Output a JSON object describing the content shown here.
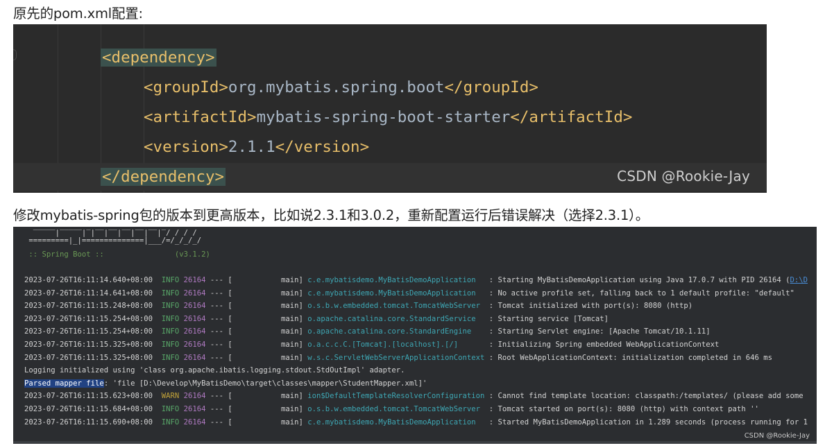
{
  "captions": {
    "top": "原先的pom.xml配置:",
    "middle": "修改mybatis-spring包的版本到更高版本，比如说2.3.1和3.0.2，重新配置运行后错误解决（选择2.3.1）。"
  },
  "code": {
    "lines": [
      {
        "open": "<dependency>"
      },
      {
        "open": "<groupId>",
        "text": "org.mybatis.spring.boot",
        "close": "</groupId>"
      },
      {
        "open": "<artifactId>",
        "text": "mybatis-spring-boot-starter",
        "close": "</artifactId>"
      },
      {
        "open": "<version>",
        "text": "2.1.1",
        "close": "</version>"
      },
      {
        "open": "</dependency>"
      }
    ],
    "watermark": "CSDN @Rookie-Jay",
    "colors": {
      "background": "#2b2b2b",
      "tag": "#e8bf6a",
      "text": "#a9b7c6",
      "tag_highlight": "#3b514d"
    }
  },
  "console": {
    "banner": [
      " =========|_|==============|___/=/_/_/_/",
      " :: Spring Boot ::                (v3.1.2)"
    ],
    "logs": [
      {
        "ts": "2023-07-26T16:11:14.640+08:00",
        "level": "INFO",
        "pid": "26164",
        "sep": "--- [",
        "thread": "           main]",
        "logger": "c.e.mybatisdemo.MyBatisDemoApplication  ",
        "msg": " : Starting MyBatisDemoApplication using Java 17.0.7 with PID 26164 (",
        "link": "D:\\D"
      },
      {
        "ts": "2023-07-26T16:11:14.641+08:00",
        "level": "INFO",
        "pid": "26164",
        "sep": "--- [",
        "thread": "           main]",
        "logger": "c.e.mybatisdemo.MyBatisDemoApplication  ",
        "msg": " : No active profile set, falling back to 1 default profile: \"default\""
      },
      {
        "ts": "2023-07-26T16:11:15.248+08:00",
        "level": "INFO",
        "pid": "26164",
        "sep": "--- [",
        "thread": "           main]",
        "logger": "o.s.b.w.embedded.tomcat.TomcatWebServer ",
        "msg": " : Tomcat initialized with port(s): 8080 (http)"
      },
      {
        "ts": "2023-07-26T16:11:15.254+08:00",
        "level": "INFO",
        "pid": "26164",
        "sep": "--- [",
        "thread": "           main]",
        "logger": "o.apache.catalina.core.StandardService  ",
        "msg": " : Starting service [Tomcat]"
      },
      {
        "ts": "2023-07-26T16:11:15.254+08:00",
        "level": "INFO",
        "pid": "26164",
        "sep": "--- [",
        "thread": "           main]",
        "logger": "o.apache.catalina.core.StandardEngine   ",
        "msg": " : Starting Servlet engine: [Apache Tomcat/10.1.11]"
      },
      {
        "ts": "2023-07-26T16:11:15.325+08:00",
        "level": "INFO",
        "pid": "26164",
        "sep": "--- [",
        "thread": "           main]",
        "logger": "o.a.c.c.C.[Tomcat].[localhost].[/]      ",
        "msg": " : Initializing Spring embedded WebApplicationContext"
      },
      {
        "ts": "2023-07-26T16:11:15.325+08:00",
        "level": "INFO",
        "pid": "26164",
        "sep": "--- [",
        "thread": "           main]",
        "logger": "w.s.c.ServletWebServerApplicationContext",
        "msg": " : Root WebApplicationContext: initialization completed in 646 ms"
      },
      {
        "plain": "Logging initialized using 'class org.apache.ibatis.logging.stdout.StdOutImpl' adapter."
      },
      {
        "selected": "Parsed mapper file",
        "plain_after": ": 'file [D:\\Develop\\MyBatisDemo\\target\\classes\\mapper\\StudentMapper.xml]'"
      },
      {
        "ts": "2023-07-26T16:11:15.623+08:00",
        "level": "WARN",
        "pid": "26164",
        "sep": "--- [",
        "thread": "           main]",
        "logger": "ion$DefaultTemplateResolverConfiguration",
        "msg": " : Cannot find template location: classpath:/templates/ (please add some"
      },
      {
        "ts": "2023-07-26T16:11:15.684+08:00",
        "level": "INFO",
        "pid": "26164",
        "sep": "--- [",
        "thread": "           main]",
        "logger": "o.s.b.w.embedded.tomcat.TomcatWebServer ",
        "msg": " : Tomcat started on port(s): 8080 (http) with context path ''"
      },
      {
        "ts": "2023-07-26T16:11:15.690+08:00",
        "level": "INFO",
        "pid": "26164",
        "sep": "--- [",
        "thread": "           main]",
        "logger": "c.e.mybatisdemo.MyBatisDemoApplication  ",
        "msg": " : Started MyBatisDemoApplication in 1.289 seconds (process running for 1"
      }
    ],
    "watermark": "CSDN @Rookie-Jay",
    "colors": {
      "background": "#2b2d30",
      "info": "#59a869",
      "warn": "#c2a339",
      "pid": "#b07ac2",
      "logger": "#3ea7b4",
      "selection": "#214283"
    }
  }
}
